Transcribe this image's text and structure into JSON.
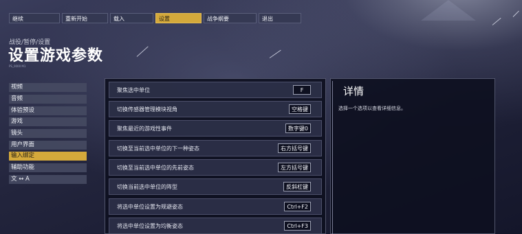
{
  "top_menu": [
    "继续",
    "重新开始",
    "载入",
    "设置",
    "战争纲要",
    "退出"
  ],
  "top_menu_active": "设置",
  "breadcrumb": "战役/暂停/设置",
  "page_title": "设置游戏参数",
  "tiny_code": "PS_0000 M1",
  "sidebar": [
    "视频",
    "音频",
    "体验预设",
    "游戏",
    "镜头",
    "用户界面",
    "输入绑定",
    "辅助功能",
    "文 ↔ A"
  ],
  "sidebar_active": "输入绑定",
  "bindings": [
    {
      "label": "聚焦选中单位",
      "key": "F"
    },
    {
      "label": "切换传感器管理模块视角",
      "key": "空格键"
    },
    {
      "label": "聚焦最近的游戏性事件",
      "key": "数字键0"
    },
    {
      "label": "切换至当前选中单位的下一种姿态",
      "key": "右方括号键"
    },
    {
      "label": "切换至当前选中单位的先前姿态",
      "key": "左方括号键"
    },
    {
      "label": "切换当前选中单位的阵型",
      "key": "反斜杠键"
    },
    {
      "label": "将选中单位设置为规避姿态",
      "key": "Ctrl+F2"
    },
    {
      "label": "将选中单位设置为均衡姿态",
      "key": "Ctrl+F3"
    }
  ],
  "details": {
    "title": "详情",
    "text": "选择一个选项以查看详细信息。"
  },
  "colors": {
    "accent": "#d4a93b",
    "panel": "#0e1020",
    "button": "#343852"
  }
}
